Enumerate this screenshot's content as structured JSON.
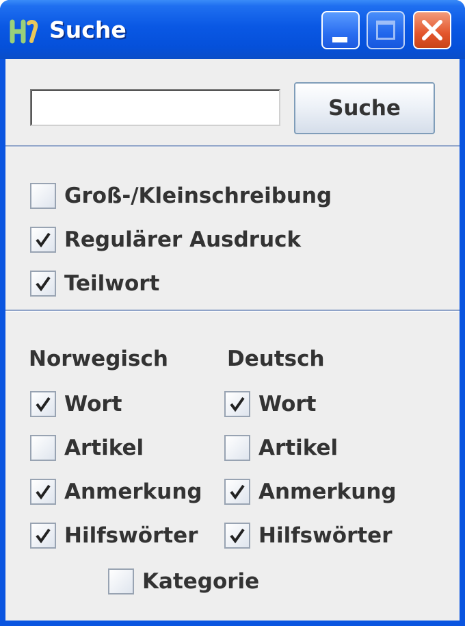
{
  "window": {
    "title": "Suche",
    "controls": {
      "minimize": "minimize",
      "maximize": "maximize",
      "close": "close"
    }
  },
  "search": {
    "value": "",
    "placeholder": "",
    "button_label": "Suche"
  },
  "options": [
    {
      "label": "Groß-/Kleinschreibung",
      "checked": false
    },
    {
      "label": "Regulärer Ausdruck",
      "checked": true
    },
    {
      "label": "Teilwort",
      "checked": true
    }
  ],
  "columns": {
    "norwegian": {
      "heading": "Norwegisch",
      "items": [
        {
          "label": "Wort",
          "checked": true
        },
        {
          "label": "Artikel",
          "checked": false
        },
        {
          "label": "Anmerkung",
          "checked": true
        },
        {
          "label": "Hilfswörter",
          "checked": true
        }
      ]
    },
    "german": {
      "heading": "Deutsch",
      "items": [
        {
          "label": "Wort",
          "checked": true
        },
        {
          "label": "Artikel",
          "checked": false
        },
        {
          "label": "Anmerkung",
          "checked": true
        },
        {
          "label": "Hilfswörter",
          "checked": true
        }
      ]
    }
  },
  "category": {
    "label": "Kategorie",
    "checked": false
  },
  "colors": {
    "title_bar": "#0a55e0",
    "close_button": "#e3552c",
    "panel_background": "#eeeeee"
  }
}
